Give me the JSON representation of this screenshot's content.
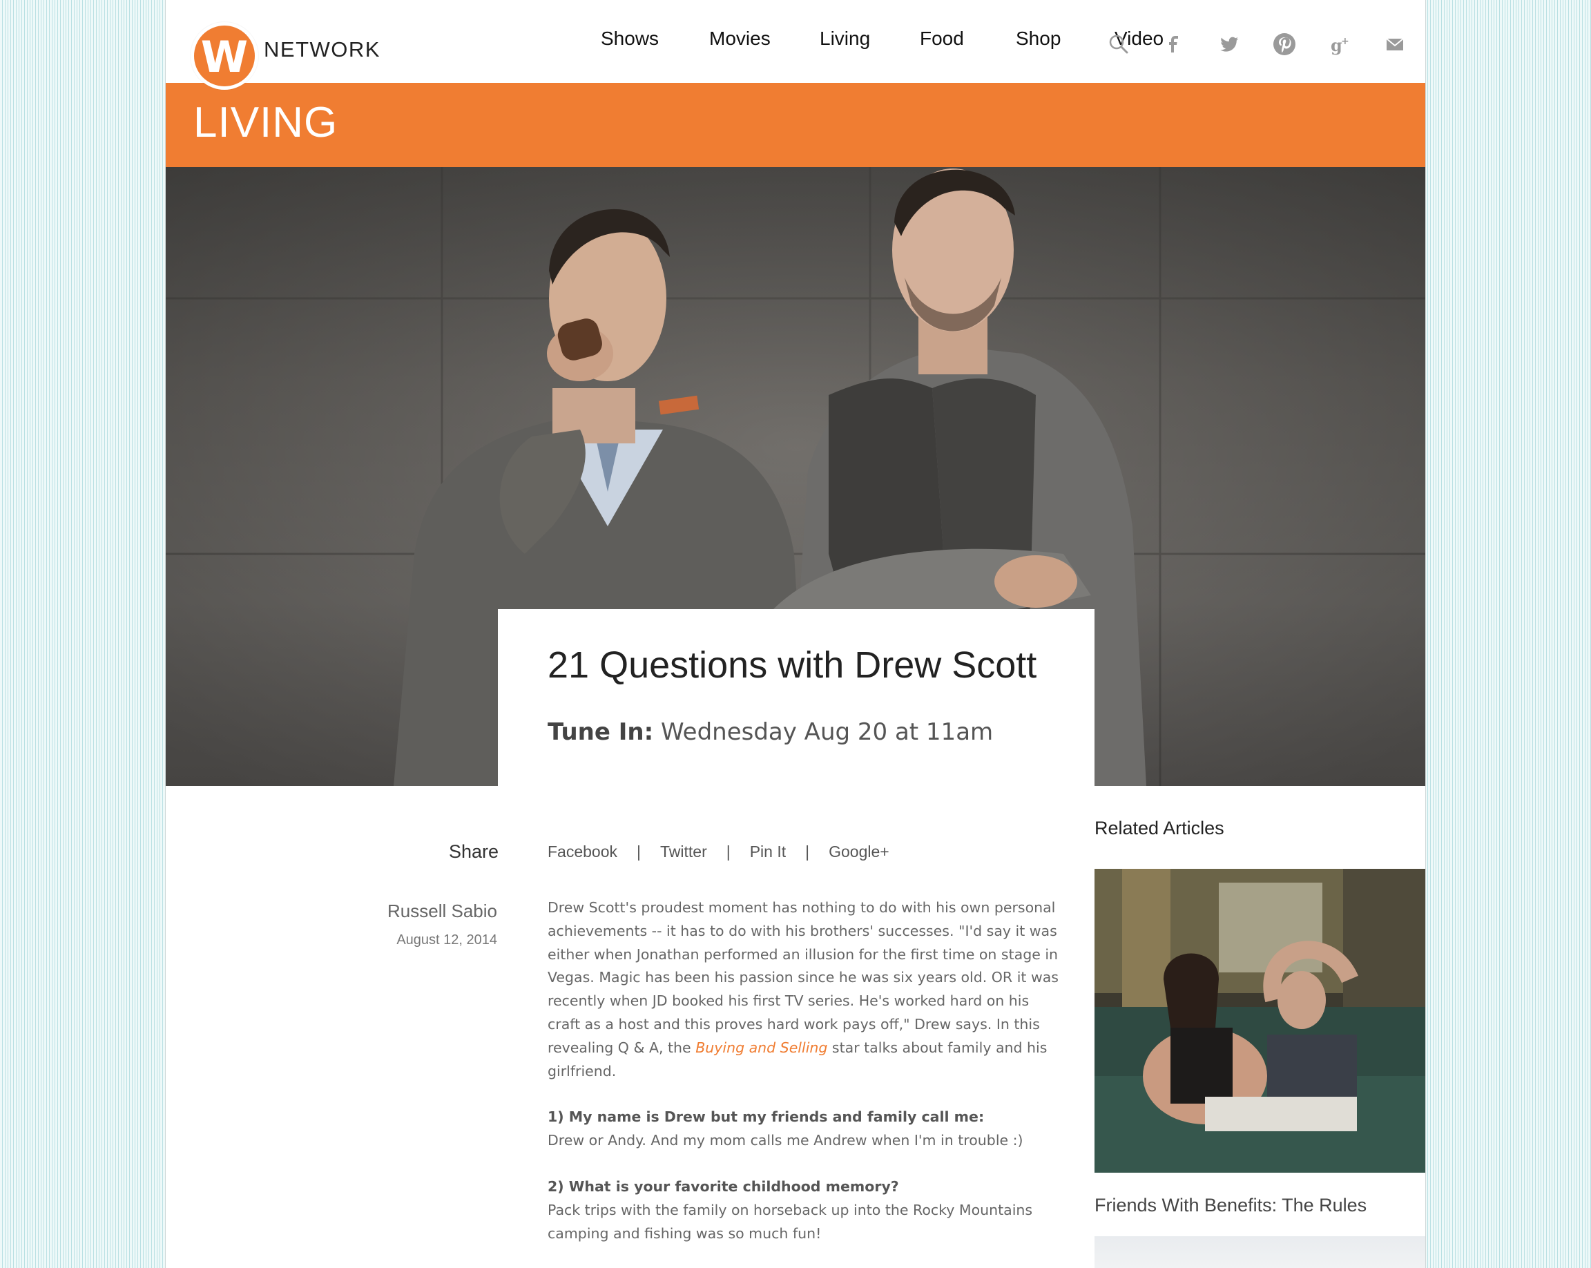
{
  "brand": {
    "logo_letter": "W",
    "logo_text": "NETWORK",
    "accent": "#f07d32"
  },
  "nav": {
    "items": [
      "Shows",
      "Movies",
      "Living",
      "Food",
      "Shop",
      "Video"
    ]
  },
  "header_icons": [
    "search-icon",
    "facebook-icon",
    "twitter-icon",
    "pinterest-icon",
    "google-plus-icon",
    "email-icon"
  ],
  "section": {
    "title": "LIVING"
  },
  "article": {
    "title": "21 Questions with Drew Scott",
    "tune_in_label": "Tune In:",
    "tune_in_value": "Wednesday Aug 20 at 11am",
    "share_label": "Share",
    "share_links": [
      "Facebook",
      "Twitter",
      "Pin It",
      "Google+"
    ],
    "author": "Russell Sabio",
    "date": "August 12, 2014",
    "intro_before_link": "Drew Scott's proudest moment has nothing to do with his own personal achievements -- it has to do with his brothers' successes. \"I'd say it was either when Jonathan performed an illusion for the first time on stage in Vegas. Magic has been his passion since he was six years old. OR it was recently when JD booked his first TV series. He's worked hard on his craft as a host and this proves hard work pays off,\" Drew says. In this revealing Q & A, the ",
    "intro_link": "Buying and Selling",
    "intro_after_link": " star talks about family and his girlfriend.",
    "qa": [
      {
        "q": "1) My name is Drew but my friends and family call me:",
        "a": "Drew or Andy. And my mom calls me Andrew when I'm in trouble :)"
      },
      {
        "q": "2) What is your favorite childhood memory?",
        "a": "Pack trips with the family on horseback up into the Rocky Mountains camping and fishing was so much fun!"
      }
    ]
  },
  "sidebar": {
    "heading": "Related Articles",
    "items": [
      {
        "title": "Friends With Benefits: The Rules"
      }
    ]
  }
}
